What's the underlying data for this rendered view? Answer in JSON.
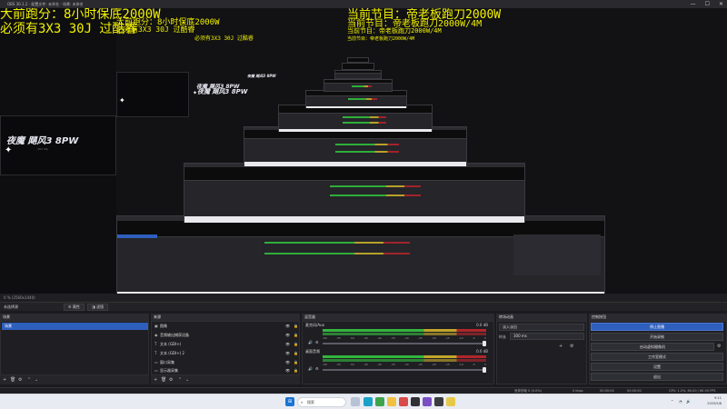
{
  "window": {
    "title": "OBS 30.1.2 - 配置文件: 未命名 - 场景: 未命名",
    "min_label": "—",
    "max_label": "☐",
    "close_label": "✕"
  },
  "preview": {
    "overlay_left_line1": "大前跑分：8小时保底2000W",
    "overlay_left_line2": "必须有3X3 30J 过酷睿",
    "overlay_right_line1": "当前节目：帝老板跑刀2000W",
    "overlay_right_line2": "当前节目：帝老板跑刀2000W/4M",
    "logo_text": "夜魔 飓风3 8PW",
    "small_label": "3X3 30J",
    "sparkle_glyph": "✦"
  },
  "statusline": {
    "text": "0 %  (2560x1440)"
  },
  "panel_row": {
    "label": "未选择源",
    "props_label": "⚙ 属性",
    "filters_label": "◨ 滤镜"
  },
  "scenes": {
    "title": "场景",
    "items": [
      {
        "label": "场景"
      }
    ]
  },
  "sources": {
    "title": "来源",
    "items": [
      {
        "icon": "▣",
        "name": "图像"
      },
      {
        "icon": "◉",
        "name": "音频输出捕获设备"
      },
      {
        "icon": "T",
        "name": "文本 (GDI+)"
      },
      {
        "icon": "T",
        "name": "文本 (GDI+) 2"
      },
      {
        "icon": "▭",
        "name": "窗口采集"
      },
      {
        "icon": "▭",
        "name": "显示器采集"
      }
    ],
    "vis_icon": "👁",
    "lock_icon": "🔒"
  },
  "mixer": {
    "title": "混音器",
    "channels": [
      {
        "name": "麦克风/Aux",
        "db": "0.0 dB"
      },
      {
        "name": "桌面音频",
        "db": "0.0 dB"
      }
    ],
    "ticks": [
      "-60",
      "-55",
      "-50",
      "-45",
      "-40",
      "-35",
      "-30",
      "-25",
      "-20",
      "-15",
      "-10",
      "-5",
      "0"
    ],
    "gear_icon": "⚙",
    "speaker_icon": "🔊"
  },
  "transitions": {
    "title": "转场动画",
    "type_value": "淡入淡出",
    "duration_label": "时长",
    "duration_value": "300 ms",
    "add_icon": "+",
    "gear_icon": "⚙"
  },
  "controls": {
    "title": "控制按钮",
    "buttons": [
      "停止直播",
      "开始录制",
      "启动虚拟摄像机",
      "工作室模式",
      "设置",
      "退出"
    ],
    "vcam_gear": "⚙"
  },
  "status": {
    "dropped": "丢弃的帧 0 (0.0%)",
    "bitrate": "0 kbps",
    "time1": "00:00:00",
    "time2": "00:00:00",
    "cpu": "CPU: 1.2%, 60.00 / 60.00 FPS"
  },
  "dock_footer": {
    "add": "+",
    "remove": "🗑",
    "config": "⚙",
    "up": "⌃",
    "down": "⌄"
  },
  "taskbar": {
    "search_placeholder": "搜索",
    "search_icon": "⌕",
    "time": "9:11",
    "date": "2025/5/8",
    "tray_chevron": "⌃",
    "wifi": "◔",
    "volume": "🔊"
  },
  "colors": {
    "accent": "#2f5fbd",
    "overlay_yellow": "#f2f000"
  }
}
